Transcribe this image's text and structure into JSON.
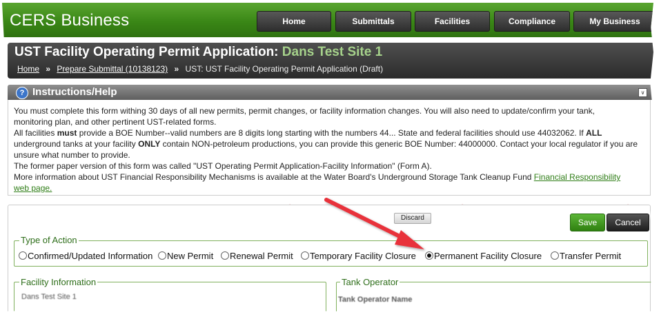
{
  "app": {
    "brand": "CERS Business"
  },
  "nav": {
    "items": [
      {
        "label": "Home"
      },
      {
        "label": "Submittals"
      },
      {
        "label": "Facilities"
      },
      {
        "label": "Compliance"
      },
      {
        "label": "My Business"
      }
    ]
  },
  "page": {
    "title_prefix": "UST Facility Operating Permit Application:",
    "site_name": "Dans Test Site 1"
  },
  "breadcrumb": {
    "home": "Home",
    "sep": "»",
    "submittal": "Prepare Submittal (10138123)",
    "current": "UST: UST Facility Operating Permit Application (Draft)"
  },
  "help": {
    "title": "Instructions/Help",
    "icon": "question-icon",
    "line1": "You must complete this form withing 30 days of all new permits, permit changes, or facility information changes. You will also need to update/confirm your tank,",
    "line2": "monitoring plan, and other pertinent UST-related forms.",
    "line3a": "All facilities ",
    "line3b": "must",
    "line3c": " provide a BOE Number--valid numbers are 8 digits long starting with the numbers 44... State and federal facilities should use 44032062. If ",
    "line3d": "ALL",
    "line4a": "underground tanks at your facility ",
    "line4b": "ONLY",
    "line4c": " contain NON-petroleum productions, you can provide this generic BOE Number: 44000000. Contact your local regulator if you are",
    "line5": "unsure what number to provide.",
    "line6": "The former paper version of this form was called \"UST Operating Permit Application-Facility Information\" (Form A).",
    "line7": "More information about UST Financial Responsibility Mechanisms is available at the Water Board's Underground Storage Tank Cleanup Fund ",
    "link1": "Financial Responsibility",
    "link2": "web page."
  },
  "form": {
    "discard": "Discard",
    "save": "Save",
    "cancel": "Cancel",
    "action_legend": "Type of Action",
    "options": [
      {
        "label": "Confirmed/Updated Information",
        "selected": false
      },
      {
        "label": "New Permit",
        "selected": false
      },
      {
        "label": "Renewal Permit",
        "selected": false
      },
      {
        "label": "Temporary Facility Closure",
        "selected": false
      },
      {
        "label": "Permanent Facility Closure",
        "selected": true
      },
      {
        "label": "Transfer Permit",
        "selected": false
      }
    ],
    "facility_legend": "Facility Information",
    "facility_value": "Dans Test Site 1",
    "operator_legend": "Tank Operator",
    "operator_field": "Tank Operator Name"
  },
  "colors": {
    "header_green": "#3a8716",
    "arrow_red": "#e8303a",
    "save_green": "#3c9a1c"
  }
}
